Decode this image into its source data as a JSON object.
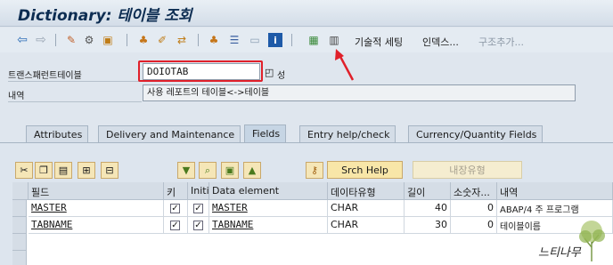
{
  "window": {
    "title": "Dictionary: 테이블 조회"
  },
  "toolbar": {
    "tech_settings": "기술적 세팅",
    "indexes": "인덱스...",
    "append_structure": "구조추가..."
  },
  "header": {
    "table_label": "트랜스패런트테이블",
    "table_value": "DOIOTAB",
    "table_suffix": "ᄋ",
    "table_status": "성",
    "desc_label": "내역",
    "desc_value": "사용 레포트의 테이블<->테이블"
  },
  "tabs": [
    {
      "label": "Attributes"
    },
    {
      "label": "Delivery and Maintenance"
    },
    {
      "label": "Fields"
    },
    {
      "label": "Entry help/check"
    },
    {
      "label": "Currency/Quantity Fields"
    }
  ],
  "field_buttons": {
    "search_help": "Srch Help",
    "builtin_type": "내장유형"
  },
  "grid": {
    "columns": [
      "필드",
      "키",
      "Initi...",
      "Data element",
      "데이타유형",
      "길이",
      "소숫자...",
      "내역"
    ],
    "rows": [
      {
        "field": "MASTER",
        "key": true,
        "initial": true,
        "data_element": "MASTER",
        "type": "CHAR",
        "length": "40",
        "decimals": "0",
        "desc": "ABAP/4 주 프로그램"
      },
      {
        "field": "TABNAME",
        "key": true,
        "initial": true,
        "data_element": "TABNAME",
        "type": "CHAR",
        "length": "30",
        "decimals": "0",
        "desc": "테이블이름"
      }
    ]
  },
  "watermark": {
    "text": "느티나무"
  },
  "colors": {
    "highlight": "#e0202a",
    "title": "#0d2d52"
  }
}
